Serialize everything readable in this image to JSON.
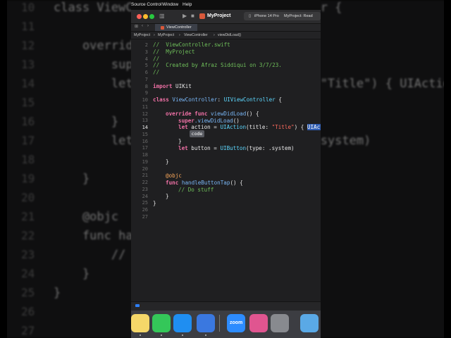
{
  "background_editor": {
    "lines": [
      {
        "num": "10",
        "text": "class ViewController: UIViewController {"
      },
      {
        "num": "11",
        "text": ""
      },
      {
        "num": "12",
        "text": "    override func viewDidLoad() {"
      },
      {
        "num": "13",
        "text": "        super.viewDidLoad()"
      },
      {
        "num": "14",
        "text": "        let action = UIAction(title: \"Title\") { UIAction"
      },
      {
        "num": "15",
        "text": ""
      },
      {
        "num": "16",
        "text": "        }"
      },
      {
        "num": "17",
        "text": "        let button = UIButton(type: .system)"
      },
      {
        "num": "18",
        "text": ""
      },
      {
        "num": "19",
        "text": "    }"
      },
      {
        "num": "20",
        "text": ""
      },
      {
        "num": "21",
        "text": "    @objc"
      },
      {
        "num": "22",
        "text": "    func handleButtonTap() {"
      },
      {
        "num": "23",
        "text": "        // Do stuff"
      },
      {
        "num": "24",
        "text": "    }"
      },
      {
        "num": "25",
        "text": "}"
      },
      {
        "num": "26",
        "text": ""
      },
      {
        "num": "27",
        "text": ""
      }
    ]
  },
  "menubar": {
    "items": [
      "Source Control",
      "Window",
      "Help"
    ]
  },
  "toolbar": {
    "project_name": "MyProject",
    "device": "iPhone 14 Pro",
    "status": "MyProject: Read"
  },
  "tab": {
    "label": "ViewController"
  },
  "jumpbar": {
    "crumbs": [
      "MyProject",
      "MyProject",
      "ViewController",
      "viewDidLoad()"
    ]
  },
  "editor": {
    "current_line": "14",
    "placeholder_token": "code",
    "line_numbers": [
      "2",
      "3",
      "4",
      "5",
      "6",
      "7",
      "8",
      "9",
      "10",
      "11",
      "12",
      "13",
      "14",
      "15",
      "16",
      "17",
      "18",
      "19",
      "20",
      "21",
      "22",
      "23",
      "24",
      "25",
      "26",
      "27"
    ],
    "lines": {
      "l2": "//  ViewController.swift",
      "l3": "//  MyProject",
      "l4": "//",
      "l5": "//  Created by Afraz Siddiqui on 3/7/23.",
      "l6": "//",
      "l8_kw": "import",
      "l8_rest": " UIKit",
      "l10_kw": "class",
      "l10_name": " ViewController",
      "l10_colon": ": ",
      "l10_type": "UIViewController",
      "l10_brace": " {",
      "l12_kw": "override func",
      "l12_fn": " viewDidLoad",
      "l12_rest": "() {",
      "l13_kw": "super",
      "l13_fn": ".viewDidLoad",
      "l13_rest": "()",
      "l14_kw": "let",
      "l14_a": " action = ",
      "l14_type": "UIAction",
      "l14_b": "(title: ",
      "l14_str": "\"Title\"",
      "l14_c": ") { ",
      "l14_hl": "UIAct",
      "l16": "}",
      "l17_kw": "let",
      "l17_a": " button = ",
      "l17_type": "UIButton",
      "l17_b": "(type: .",
      "l17_c": "system",
      "l17_d": ")",
      "l19": "}",
      "l21": "@objc",
      "l22_kw": "func",
      "l22_fn": " handleButtonTap",
      "l22_rest": "() {",
      "l23": "// Do stuff",
      "l24": "}",
      "l25": "}"
    }
  },
  "dock": {
    "apps": [
      {
        "name": "notes-icon",
        "color": "#f5d769"
      },
      {
        "name": "messages-icon",
        "color": "#34c759"
      },
      {
        "name": "app-store-icon",
        "color": "#1f8ef1"
      },
      {
        "name": "xcode-icon",
        "color": "#3a78e0"
      },
      {
        "name": "zoom-icon",
        "color": "#2d8cff"
      },
      {
        "name": "instruments-icon",
        "color": "#e05590"
      },
      {
        "name": "quicktime-icon",
        "color": "#888a8f"
      },
      {
        "name": "folder-icon",
        "color": "#5aa9e6"
      }
    ],
    "zoom_label": "zoom"
  }
}
